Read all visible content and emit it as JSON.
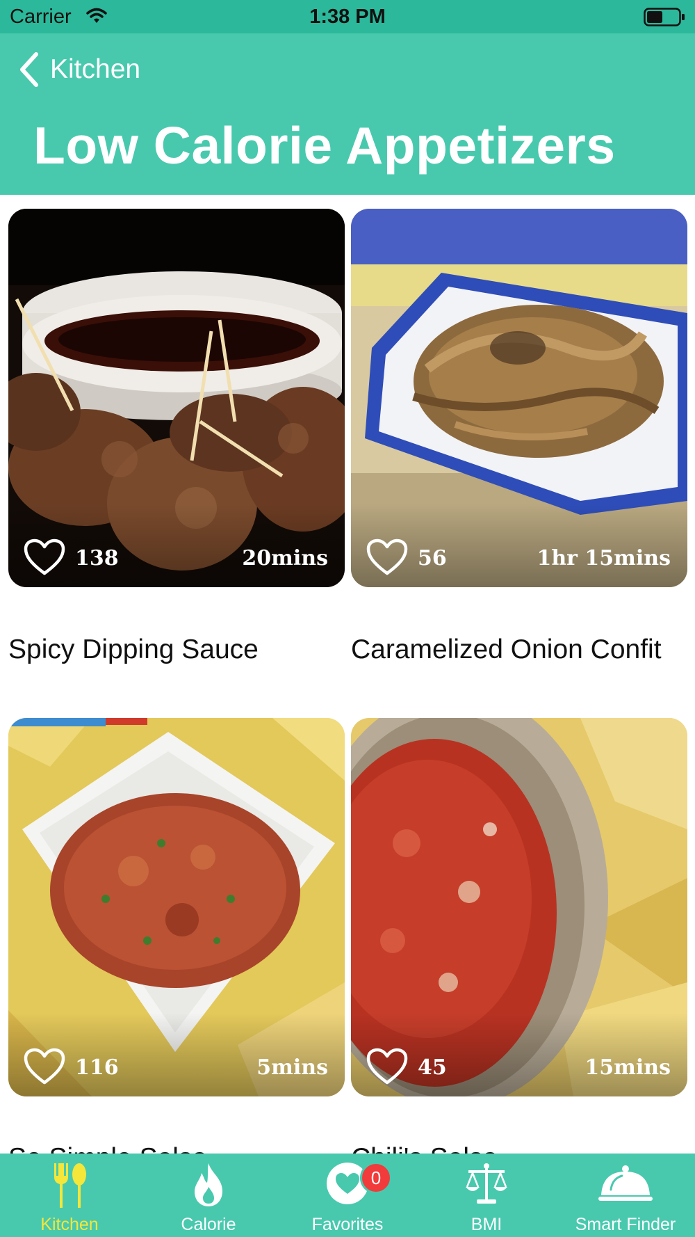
{
  "status_bar": {
    "carrier": "Carrier",
    "time": "1:38 PM"
  },
  "header": {
    "back_label": "Kitchen",
    "title": "Low Calorie Appetizers"
  },
  "recipes": [
    {
      "title": "Spicy Dipping Sauce",
      "likes": "138",
      "duration": "20mins"
    },
    {
      "title": "Caramelized Onion Confit",
      "likes": "56",
      "duration": "1hr 15mins"
    },
    {
      "title": "So Simple Salsa",
      "likes": "116",
      "duration": "5mins"
    },
    {
      "title": "Chili's Salsa",
      "likes": "45",
      "duration": "15mins"
    }
  ],
  "tabs": [
    {
      "label": "Kitchen",
      "icon": "fork-spoon-icon",
      "active": true
    },
    {
      "label": "Calorie",
      "icon": "flame-icon"
    },
    {
      "label": "Favorites",
      "icon": "heart-icon",
      "badge": "0"
    },
    {
      "label": "BMI",
      "icon": "scale-icon"
    },
    {
      "label": "Smart Finder",
      "icon": "cloche-icon"
    }
  ],
  "colors": {
    "header": "#48c9ae",
    "status_bar": "#2cb89a",
    "active_tab": "#f5e63a",
    "badge": "#f23b3b"
  }
}
